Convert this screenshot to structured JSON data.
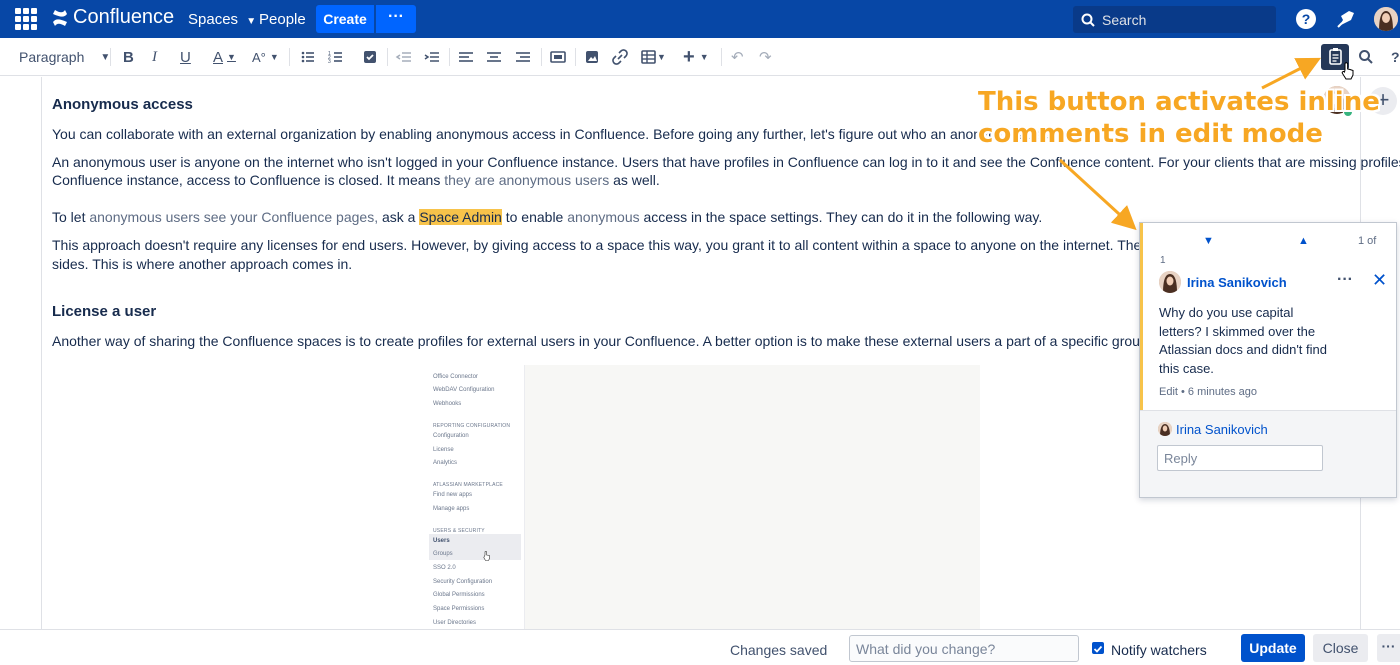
{
  "topbar": {
    "logo_text": "Confluence",
    "nav_spaces": "Spaces",
    "nav_people": "People",
    "create_label": "Create",
    "more_label": "···",
    "search_placeholder": "Search"
  },
  "toolbar": {
    "paragraph_label": "Paragraph"
  },
  "document": {
    "heading1": "Anonymous access",
    "p1": "You can collaborate with an external organization by enabling anonymous access in Confluence. Before going any further, let's figure out who an anonymous user i",
    "p2_line1": "An anonymous user is anyone on the internet who isn't logged in your Confluence instance. Users that have profiles in Confluence can log in to it and see the Confluence content. For your clients that are missing profiles in your",
    "p2_line2_a": "Confluence instance, access to Confluence is closed. It means ",
    "p2_line2_b": "they are anonymous users",
    "p2_line2_c": " as well.",
    "p3_a": "To let ",
    "p3_b": "anonymous users see your Confluence pages,",
    "p3_c": " ask a ",
    "p3_highlight": "Space Admin",
    "p3_d": " to enable ",
    "p3_e": "anonymous",
    "p3_f": " access in the space settings. They can do it in the following way.",
    "p4_line1": "This approach doesn't require any licenses for end users. However, by giving access to a space this way, you grant it to all content within a space to anyone on the internet. The information sha",
    "p4_line2": "sides. This is where another approach comes in.",
    "heading2": "License a user",
    "p5": "Another way of sharing the Confluence spaces is to create profiles for external users in your Confluence. A better option is to make these external users a part of a specific group in user manag"
  },
  "embedded_screenshot": {
    "items": [
      "Office Connector",
      "WebDAV Configuration",
      "Webhooks",
      "REPORTING CONFIGURATION",
      "Configuration",
      "License",
      "Analytics",
      "ATLASSIAN MARKETPLACE",
      "Find new apps",
      "Manage apps",
      "USERS & SECURITY",
      "Users",
      "Groups",
      "SSO 2.0",
      "Security Configuration",
      "Global Permissions",
      "Space Permissions",
      "User Directories"
    ]
  },
  "annotation": {
    "line1": "This button activates inline",
    "line2": "comments in edit mode"
  },
  "comment_panel": {
    "count": "1 of",
    "number": "1",
    "author": "Irina Sanikovich",
    "more": "···",
    "close": "✕",
    "text": "Why do you use capital letters? I skimmed over the Atlassian docs and didn't find this case.",
    "meta": "Edit • 6 minutes ago",
    "reply_author": "Irina Sanikovich",
    "reply_placeholder": "Reply"
  },
  "footer": {
    "changes_saved": "Changes saved",
    "change_placeholder": "What did you change?",
    "notify_label": "Notify watchers",
    "update_label": "Update",
    "close_label": "Close",
    "more_label": "···"
  },
  "colors": {
    "topbar": "#0747a6",
    "create": "#0065ff",
    "highlight": "#f7c34a",
    "annotation": "#f7a723",
    "link": "#0052cc"
  }
}
